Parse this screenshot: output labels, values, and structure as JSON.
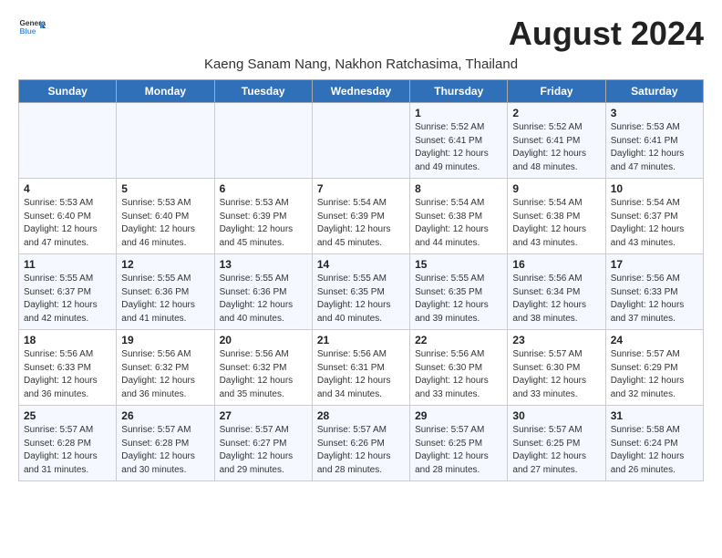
{
  "logo": {
    "general": "General",
    "blue": "Blue"
  },
  "title": "August 2024",
  "subtitle": "Kaeng Sanam Nang, Nakhon Ratchasima, Thailand",
  "weekdays": [
    "Sunday",
    "Monday",
    "Tuesday",
    "Wednesday",
    "Thursday",
    "Friday",
    "Saturday"
  ],
  "weeks": [
    [
      {
        "day": "",
        "info": ""
      },
      {
        "day": "",
        "info": ""
      },
      {
        "day": "",
        "info": ""
      },
      {
        "day": "",
        "info": ""
      },
      {
        "day": "1",
        "info": "Sunrise: 5:52 AM\nSunset: 6:41 PM\nDaylight: 12 hours\nand 49 minutes."
      },
      {
        "day": "2",
        "info": "Sunrise: 5:52 AM\nSunset: 6:41 PM\nDaylight: 12 hours\nand 48 minutes."
      },
      {
        "day": "3",
        "info": "Sunrise: 5:53 AM\nSunset: 6:41 PM\nDaylight: 12 hours\nand 47 minutes."
      }
    ],
    [
      {
        "day": "4",
        "info": "Sunrise: 5:53 AM\nSunset: 6:40 PM\nDaylight: 12 hours\nand 47 minutes."
      },
      {
        "day": "5",
        "info": "Sunrise: 5:53 AM\nSunset: 6:40 PM\nDaylight: 12 hours\nand 46 minutes."
      },
      {
        "day": "6",
        "info": "Sunrise: 5:53 AM\nSunset: 6:39 PM\nDaylight: 12 hours\nand 45 minutes."
      },
      {
        "day": "7",
        "info": "Sunrise: 5:54 AM\nSunset: 6:39 PM\nDaylight: 12 hours\nand 45 minutes."
      },
      {
        "day": "8",
        "info": "Sunrise: 5:54 AM\nSunset: 6:38 PM\nDaylight: 12 hours\nand 44 minutes."
      },
      {
        "day": "9",
        "info": "Sunrise: 5:54 AM\nSunset: 6:38 PM\nDaylight: 12 hours\nand 43 minutes."
      },
      {
        "day": "10",
        "info": "Sunrise: 5:54 AM\nSunset: 6:37 PM\nDaylight: 12 hours\nand 43 minutes."
      }
    ],
    [
      {
        "day": "11",
        "info": "Sunrise: 5:55 AM\nSunset: 6:37 PM\nDaylight: 12 hours\nand 42 minutes."
      },
      {
        "day": "12",
        "info": "Sunrise: 5:55 AM\nSunset: 6:36 PM\nDaylight: 12 hours\nand 41 minutes."
      },
      {
        "day": "13",
        "info": "Sunrise: 5:55 AM\nSunset: 6:36 PM\nDaylight: 12 hours\nand 40 minutes."
      },
      {
        "day": "14",
        "info": "Sunrise: 5:55 AM\nSunset: 6:35 PM\nDaylight: 12 hours\nand 40 minutes."
      },
      {
        "day": "15",
        "info": "Sunrise: 5:55 AM\nSunset: 6:35 PM\nDaylight: 12 hours\nand 39 minutes."
      },
      {
        "day": "16",
        "info": "Sunrise: 5:56 AM\nSunset: 6:34 PM\nDaylight: 12 hours\nand 38 minutes."
      },
      {
        "day": "17",
        "info": "Sunrise: 5:56 AM\nSunset: 6:33 PM\nDaylight: 12 hours\nand 37 minutes."
      }
    ],
    [
      {
        "day": "18",
        "info": "Sunrise: 5:56 AM\nSunset: 6:33 PM\nDaylight: 12 hours\nand 36 minutes."
      },
      {
        "day": "19",
        "info": "Sunrise: 5:56 AM\nSunset: 6:32 PM\nDaylight: 12 hours\nand 36 minutes."
      },
      {
        "day": "20",
        "info": "Sunrise: 5:56 AM\nSunset: 6:32 PM\nDaylight: 12 hours\nand 35 minutes."
      },
      {
        "day": "21",
        "info": "Sunrise: 5:56 AM\nSunset: 6:31 PM\nDaylight: 12 hours\nand 34 minutes."
      },
      {
        "day": "22",
        "info": "Sunrise: 5:56 AM\nSunset: 6:30 PM\nDaylight: 12 hours\nand 33 minutes."
      },
      {
        "day": "23",
        "info": "Sunrise: 5:57 AM\nSunset: 6:30 PM\nDaylight: 12 hours\nand 33 minutes."
      },
      {
        "day": "24",
        "info": "Sunrise: 5:57 AM\nSunset: 6:29 PM\nDaylight: 12 hours\nand 32 minutes."
      }
    ],
    [
      {
        "day": "25",
        "info": "Sunrise: 5:57 AM\nSunset: 6:28 PM\nDaylight: 12 hours\nand 31 minutes."
      },
      {
        "day": "26",
        "info": "Sunrise: 5:57 AM\nSunset: 6:28 PM\nDaylight: 12 hours\nand 30 minutes."
      },
      {
        "day": "27",
        "info": "Sunrise: 5:57 AM\nSunset: 6:27 PM\nDaylight: 12 hours\nand 29 minutes."
      },
      {
        "day": "28",
        "info": "Sunrise: 5:57 AM\nSunset: 6:26 PM\nDaylight: 12 hours\nand 28 minutes."
      },
      {
        "day": "29",
        "info": "Sunrise: 5:57 AM\nSunset: 6:25 PM\nDaylight: 12 hours\nand 28 minutes."
      },
      {
        "day": "30",
        "info": "Sunrise: 5:57 AM\nSunset: 6:25 PM\nDaylight: 12 hours\nand 27 minutes."
      },
      {
        "day": "31",
        "info": "Sunrise: 5:58 AM\nSunset: 6:24 PM\nDaylight: 12 hours\nand 26 minutes."
      }
    ]
  ]
}
